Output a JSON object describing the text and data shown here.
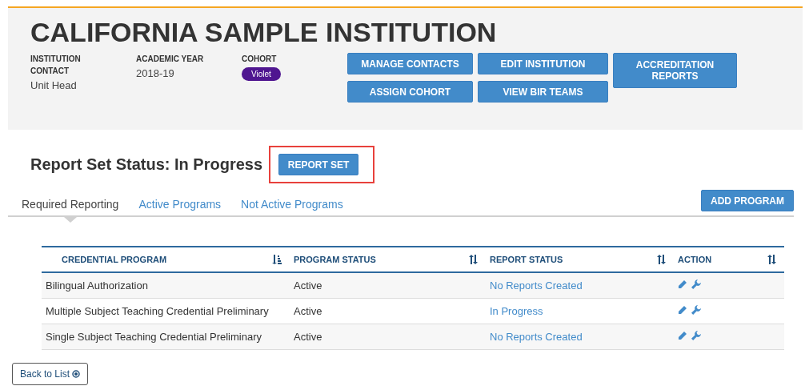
{
  "institution": {
    "name": "CALIFORNIA SAMPLE INSTITUTION",
    "fields": [
      {
        "label": "INSTITUTION CONTACT",
        "value": "Unit Head",
        "kind": "text"
      },
      {
        "label": "ACADEMIC YEAR",
        "value": "2018-19",
        "kind": "text"
      },
      {
        "label": "COHORT",
        "value": "Violet",
        "kind": "badge",
        "color": "#4f1690"
      }
    ],
    "buttons": [
      [
        "MANAGE CONTACTS",
        "ASSIGN COHORT"
      ],
      [
        "EDIT INSTITUTION",
        "VIEW BIR TEAMS"
      ],
      [
        "ACCREDITATION REPORTS"
      ]
    ]
  },
  "report_set": {
    "status": "Report Set Status: In Progress",
    "button": "REPORT SET",
    "highlighted": true
  },
  "tabs": [
    {
      "label": "Required Reporting",
      "selected": true
    },
    {
      "label": "Active Programs",
      "selected": false
    },
    {
      "label": "Not Active Programs",
      "selected": false
    }
  ],
  "add_button": "ADD PROGRAM",
  "table": {
    "columns": [
      {
        "label": "CREDENTIAL PROGRAM",
        "sorted": true
      },
      {
        "label": "PROGRAM STATUS",
        "sorted": false
      },
      {
        "label": "REPORT STATUS",
        "sorted": false
      },
      {
        "label": "ACTION",
        "sorted": false
      }
    ],
    "rows": [
      {
        "program": "Bilingual Authorization",
        "status": "Active",
        "report": "No Reports Created"
      },
      {
        "program": "Multiple Subject Teaching Credential Preliminary",
        "status": "Active",
        "report": "In Progress"
      },
      {
        "program": "Single Subject Teaching Credential Preliminary",
        "status": "Active",
        "report": "No Reports Created"
      }
    ]
  },
  "back_button": "Back to List"
}
